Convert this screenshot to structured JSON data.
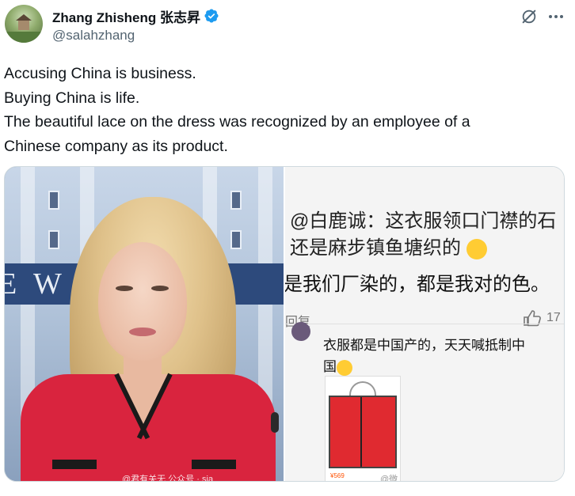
{
  "author": {
    "display_name": "Zhang Zhisheng 张志昇",
    "handle": "@salahzhang",
    "verified_color": "#1d9bf0"
  },
  "actions": {
    "grok_icon": "grok-icon",
    "more_icon": "more-icon"
  },
  "tweet": {
    "lines": [
      "Accusing China is business.",
      "Buying China is life.",
      "The beautiful lace on the dress was recognized by an employee of a",
      "Chinese company as its product."
    ]
  },
  "media": {
    "left_banner_text": "E W    OUS",
    "left_watermark": "@君有关无    公众号 · sia",
    "right": {
      "comment_1_line_1": "@白鹿诚：这衣服领口门襟的石",
      "comment_1_line_2": "还是麻步镇鱼塘织的",
      "comment_2": "是我们厂染的，都是我对的色。",
      "reply_label": "回复",
      "like_count": "17",
      "comment_3_line_1": "衣服都是中国产的，天天喊抵制中",
      "comment_3_line_2": "国",
      "price": "¥569",
      "watermark": "@微"
    }
  }
}
